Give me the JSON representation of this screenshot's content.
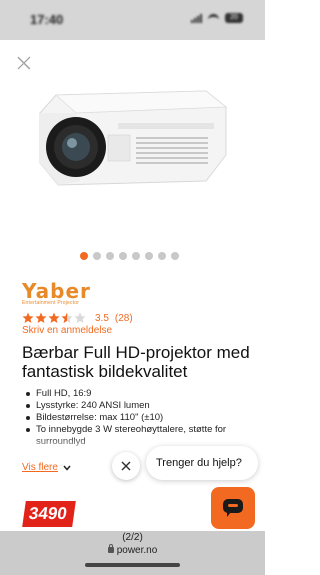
{
  "status_bar": {
    "time": "17:40",
    "battery": "20"
  },
  "gallery": {
    "image_icon": "projector-image",
    "dot_count": 8,
    "active_dot": 0
  },
  "brand": {
    "name": "Yaber",
    "tagline": "Entertainment Projector"
  },
  "rating": {
    "score": "3.5",
    "count": "(28)",
    "stars_filled": 3.5,
    "stars_total": 5,
    "review_link": "Skriv en anmeldelse"
  },
  "product": {
    "title": "Bærbar Full HD-projektor med fantastisk bildekvalitet",
    "features": [
      "Full HD, 16:9",
      "Lysstyrke: 240 ANSI lumen",
      "Bildestørrelse: max 110\" (±10)",
      "To innebygde 3 W stereohøyttalere, støtte for surroundlyd"
    ],
    "show_more": "Vis flere",
    "price": "3490"
  },
  "chat": {
    "greeting": "Trenger du hjelp?",
    "close_icon": "close-icon",
    "chat_icon": "chat-bubble-icon"
  },
  "browser": {
    "page_indicator": "(2/2)",
    "url": "power.no"
  },
  "colors": {
    "accent": "#f26a21",
    "brand": "#e8892a",
    "price_bg": "#e2231a"
  }
}
